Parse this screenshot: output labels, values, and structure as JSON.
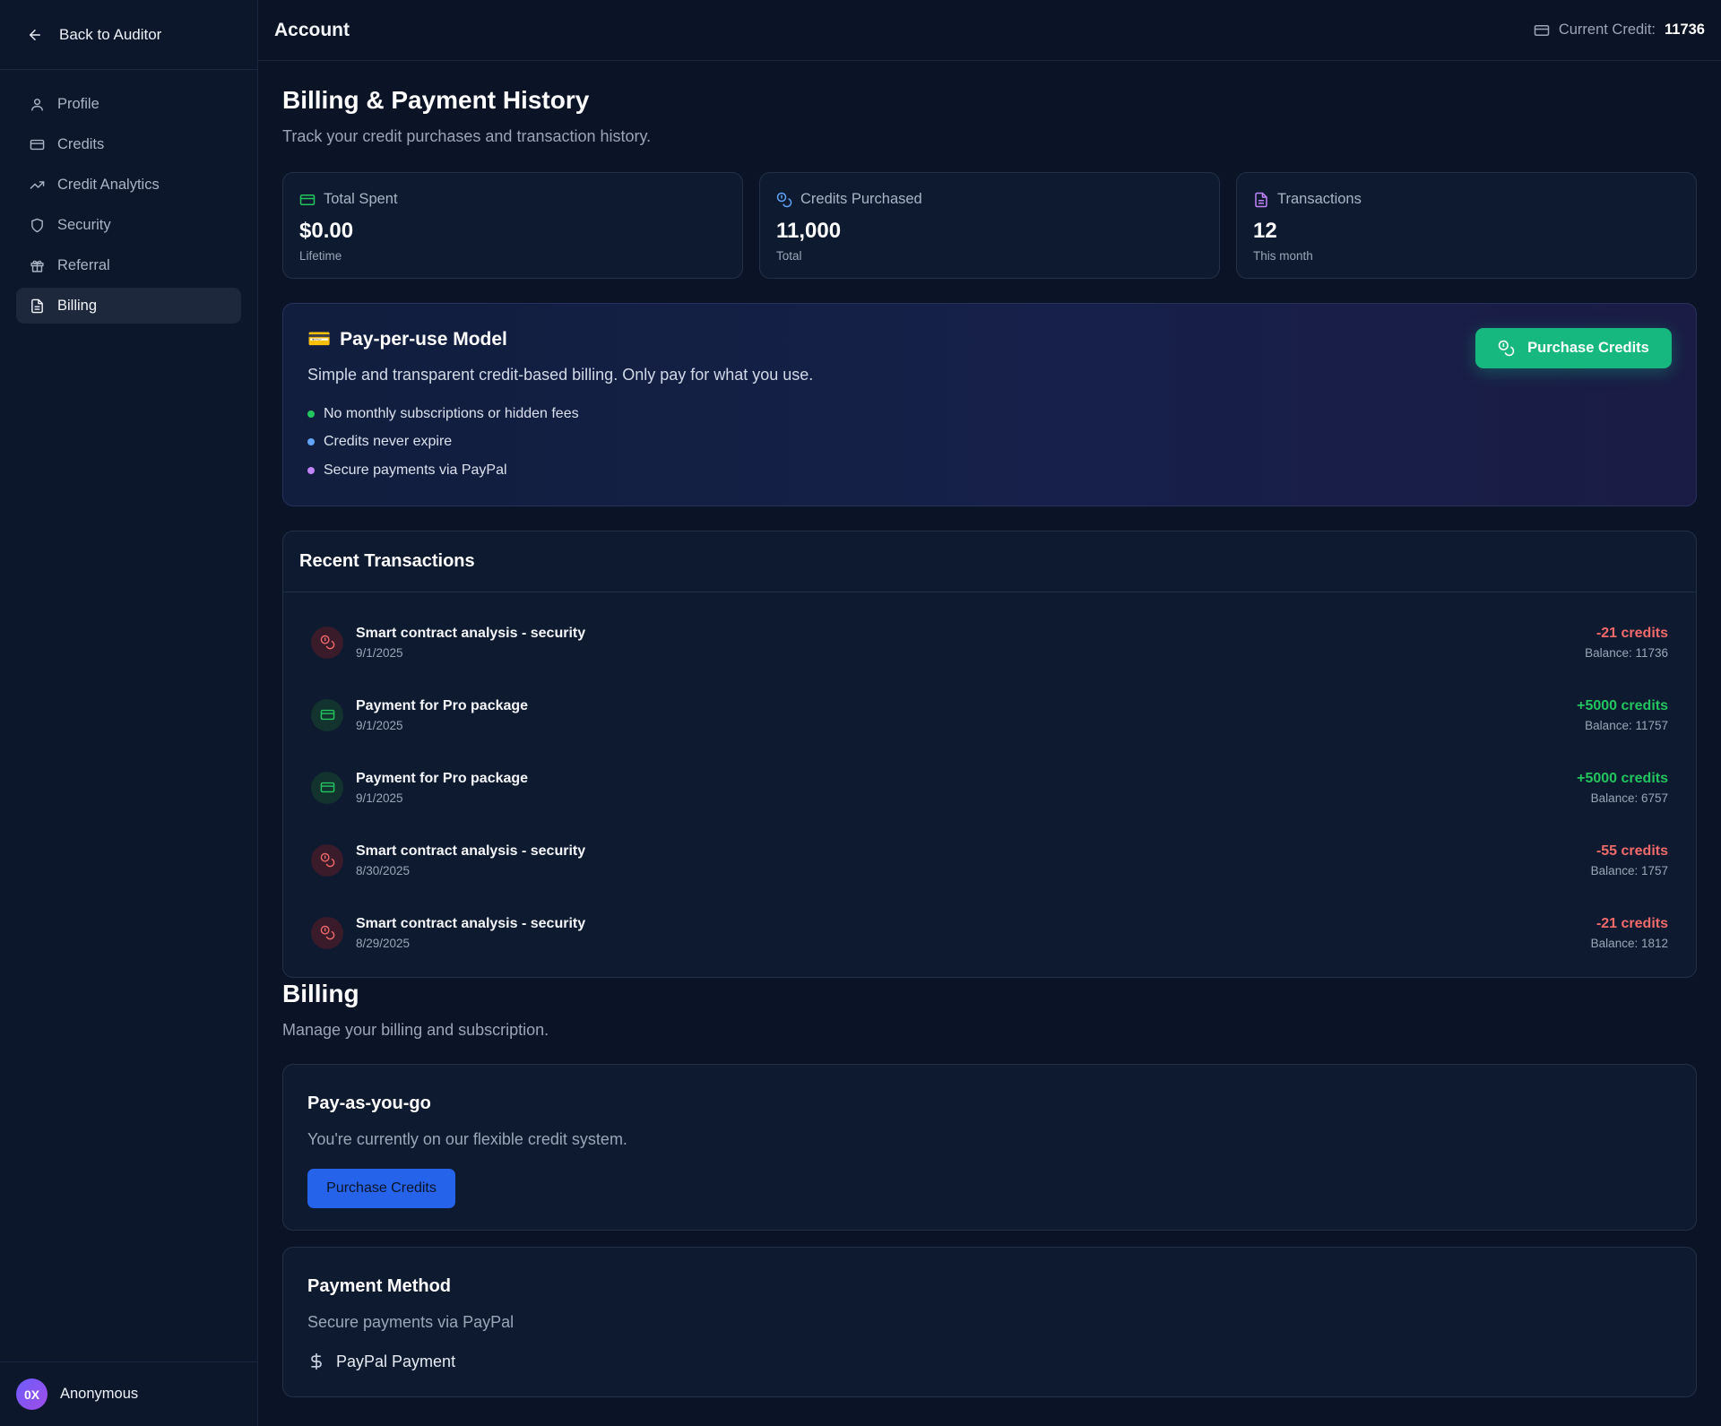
{
  "sidebar": {
    "back_label": "Back to Auditor",
    "items": [
      {
        "label": "Profile",
        "icon": "user-icon"
      },
      {
        "label": "Credits",
        "icon": "credit-card-icon"
      },
      {
        "label": "Credit Analytics",
        "icon": "trending-up-icon"
      },
      {
        "label": "Security",
        "icon": "shield-icon"
      },
      {
        "label": "Referral",
        "icon": "gift-icon"
      },
      {
        "label": "Billing",
        "icon": "file-text-icon",
        "active": true
      }
    ],
    "user": {
      "avatar_text": "0X",
      "name": "Anonymous"
    }
  },
  "header": {
    "title": "Account",
    "credit_label": "Current Credit:",
    "credit_value": "11736"
  },
  "history": {
    "title": "Billing & Payment History",
    "subtitle": "Track your credit purchases and transaction history."
  },
  "stats": [
    {
      "label": "Total Spent",
      "value": "$0.00",
      "note": "Lifetime",
      "icon": "credit-card-icon",
      "color": "#22c55e"
    },
    {
      "label": "Credits Purchased",
      "value": "11,000",
      "note": "Total",
      "icon": "coins-icon",
      "color": "#60a5fa"
    },
    {
      "label": "Transactions",
      "value": "12",
      "note": "This month",
      "icon": "file-text-icon",
      "color": "#c084fc"
    }
  ],
  "promo": {
    "emoji": "💳",
    "title": "Pay-per-use Model",
    "description": "Simple and transparent credit-based billing. Only pay for what you use.",
    "bullets": [
      {
        "text": "No monthly subscriptions or hidden fees",
        "color": "#22c55e"
      },
      {
        "text": "Credits never expire",
        "color": "#60a5fa"
      },
      {
        "text": "Secure payments via PayPal",
        "color": "#c084fc"
      }
    ],
    "button_label": "Purchase Credits"
  },
  "transactions": {
    "title": "Recent Transactions",
    "rows": [
      {
        "description": "Smart contract analysis - security",
        "date": "9/1/2025",
        "amount": "-21 credits",
        "balance": "Balance: 11736",
        "type": "debit"
      },
      {
        "description": "Payment for Pro package",
        "date": "9/1/2025",
        "amount": "+5000 credits",
        "balance": "Balance: 11757",
        "type": "credit"
      },
      {
        "description": "Payment for Pro package",
        "date": "9/1/2025",
        "amount": "+5000 credits",
        "balance": "Balance: 6757",
        "type": "credit"
      },
      {
        "description": "Smart contract analysis - security",
        "date": "8/30/2025",
        "amount": "-55 credits",
        "balance": "Balance: 1757",
        "type": "debit"
      },
      {
        "description": "Smart contract analysis - security",
        "date": "8/29/2025",
        "amount": "-21 credits",
        "balance": "Balance: 1812",
        "type": "debit"
      }
    ]
  },
  "billing": {
    "title": "Billing",
    "subtitle": "Manage your billing and subscription.",
    "plan": {
      "title": "Pay-as-you-go",
      "description": "You're currently on our flexible credit system.",
      "button_label": "Purchase Credits"
    },
    "payment": {
      "title": "Payment Method",
      "description": "Secure payments via PayPal",
      "method": "PayPal Payment",
      "icon": "dollar-sign-icon"
    }
  }
}
